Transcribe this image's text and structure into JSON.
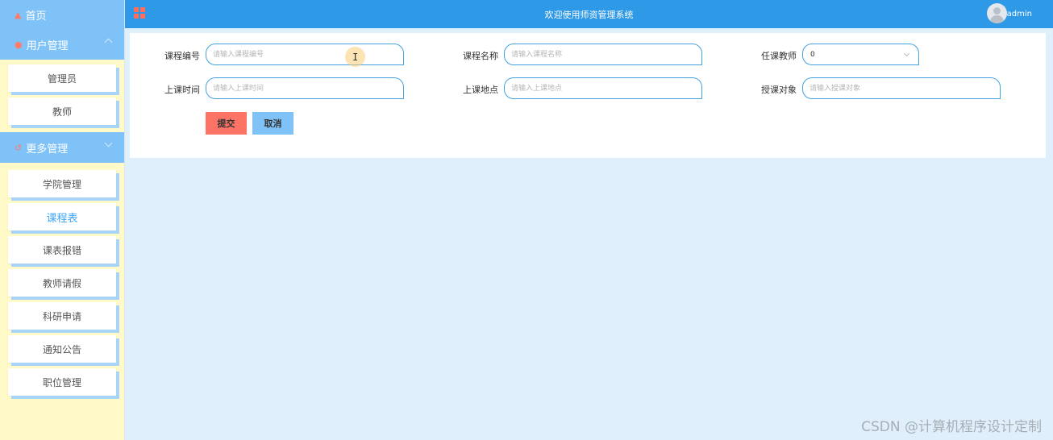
{
  "colors": {
    "header": "#2e99e6",
    "sidebar": "#fffac8",
    "sidebar_group": "#7fc2f8",
    "submit": "#fd7466",
    "cancel": "#7fc2f8",
    "accent": "#3da5f4"
  },
  "sidebar": {
    "home": {
      "icon": "home-icon",
      "label": "首页"
    },
    "groups": [
      {
        "icon": "user-icon",
        "label": "用户管理",
        "items": [
          "管理员",
          "教师"
        ]
      },
      {
        "icon": "refresh-icon",
        "label": "更多管理",
        "items": [
          "学院管理",
          "课程表",
          "课表报错",
          "教师请假",
          "科研申请",
          "通知公告",
          "职位管理"
        ]
      }
    ],
    "active_item": "课程表"
  },
  "header": {
    "title": "欢迎使用师资管理系统",
    "username": "admin"
  },
  "form": {
    "course_id": {
      "label": "课程编号",
      "placeholder": "请输入课程编号"
    },
    "course_name": {
      "label": "课程名称",
      "placeholder": "请输入课程名称"
    },
    "teacher": {
      "label": "任课教师",
      "value": "0"
    },
    "class_time": {
      "label": "上课时间",
      "placeholder": "请输入上课时间"
    },
    "class_place": {
      "label": "上课地点",
      "placeholder": "请输入上课地点"
    },
    "audience": {
      "label": "授课对象",
      "placeholder": "请输入授课对象"
    },
    "submit_label": "提交",
    "cancel_label": "取消"
  },
  "watermark": "CSDN @计算机程序设计定制"
}
